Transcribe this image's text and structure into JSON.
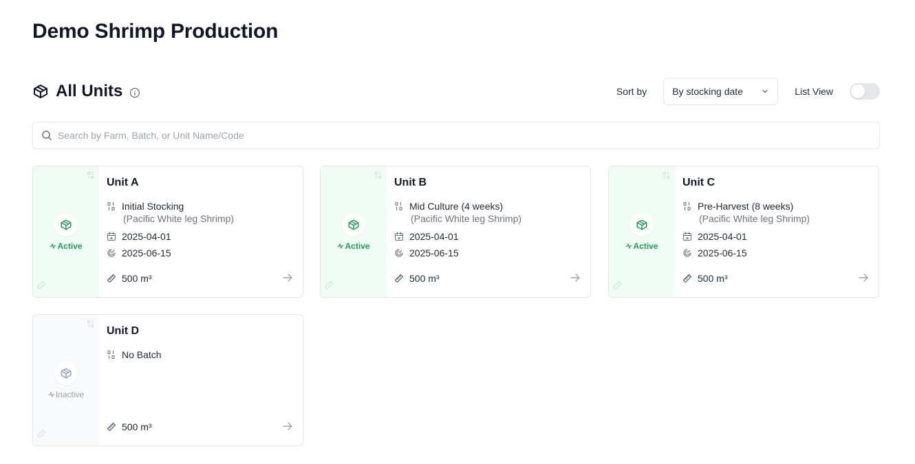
{
  "page": {
    "title": "Demo Shrimp Production"
  },
  "section": {
    "title": "All Units",
    "sort_label": "Sort by",
    "sort_value": "By stocking date",
    "list_view_label": "List View",
    "list_view_on": false
  },
  "search": {
    "placeholder": "Search by Farm, Batch, or Unit Name/Code",
    "value": ""
  },
  "colors": {
    "active_green": "#16a34a",
    "active_bg": "#f0fdf4",
    "inactive_gray": "#94a3b8"
  },
  "units": [
    {
      "name": "Unit A",
      "status": "Active",
      "batch": "Initial Stocking",
      "species": "(Pacific White leg Shrimp)",
      "stocking_date": "2025-04-01",
      "harvest_date": "2025-06-15",
      "volume": "500 m³"
    },
    {
      "name": "Unit B",
      "status": "Active",
      "batch": "Mid Culture (4 weeks)",
      "species": "(Pacific White leg Shrimp)",
      "stocking_date": "2025-04-01",
      "harvest_date": "2025-06-15",
      "volume": "500 m³"
    },
    {
      "name": "Unit C",
      "status": "Active",
      "batch": "Pre-Harvest (8 weeks)",
      "species": "(Pacific White leg Shrimp)",
      "stocking_date": "2025-04-01",
      "harvest_date": "2025-06-15",
      "volume": "500 m³"
    },
    {
      "name": "Unit D",
      "status": "Inactive",
      "batch": "No Batch",
      "volume": "500 m³"
    }
  ]
}
